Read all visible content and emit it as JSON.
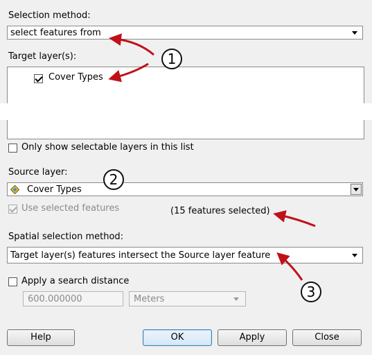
{
  "selection_method": {
    "label": "Selection method:",
    "value": "select features from"
  },
  "target_layers": {
    "label": "Target layer(s):",
    "items": [
      {
        "label": "Cover Types",
        "checked": true
      }
    ]
  },
  "only_show_selectable": {
    "label": "Only show selectable layers in this list",
    "checked": false
  },
  "source_layer": {
    "label": "Source layer:",
    "value": "Cover Types",
    "icon": "layer-diamond-icon"
  },
  "use_selected": {
    "label": "Use selected features",
    "checked": true,
    "enabled": false,
    "status": "(15 features selected)"
  },
  "spatial_method": {
    "label": "Spatial selection method:",
    "value": "Target layer(s) features intersect the Source layer feature"
  },
  "search_distance": {
    "label": "Apply a search distance",
    "checked": false,
    "value": "600.000000",
    "units": "Meters"
  },
  "buttons": {
    "help": "Help",
    "ok": "OK",
    "apply": "Apply",
    "close": "Close"
  },
  "callouts": {
    "one": "1",
    "two": "2",
    "three": "3"
  },
  "colors": {
    "arrow": "#c0111a",
    "panel": "#f0f0f0",
    "accent": "#3c7fb1"
  }
}
